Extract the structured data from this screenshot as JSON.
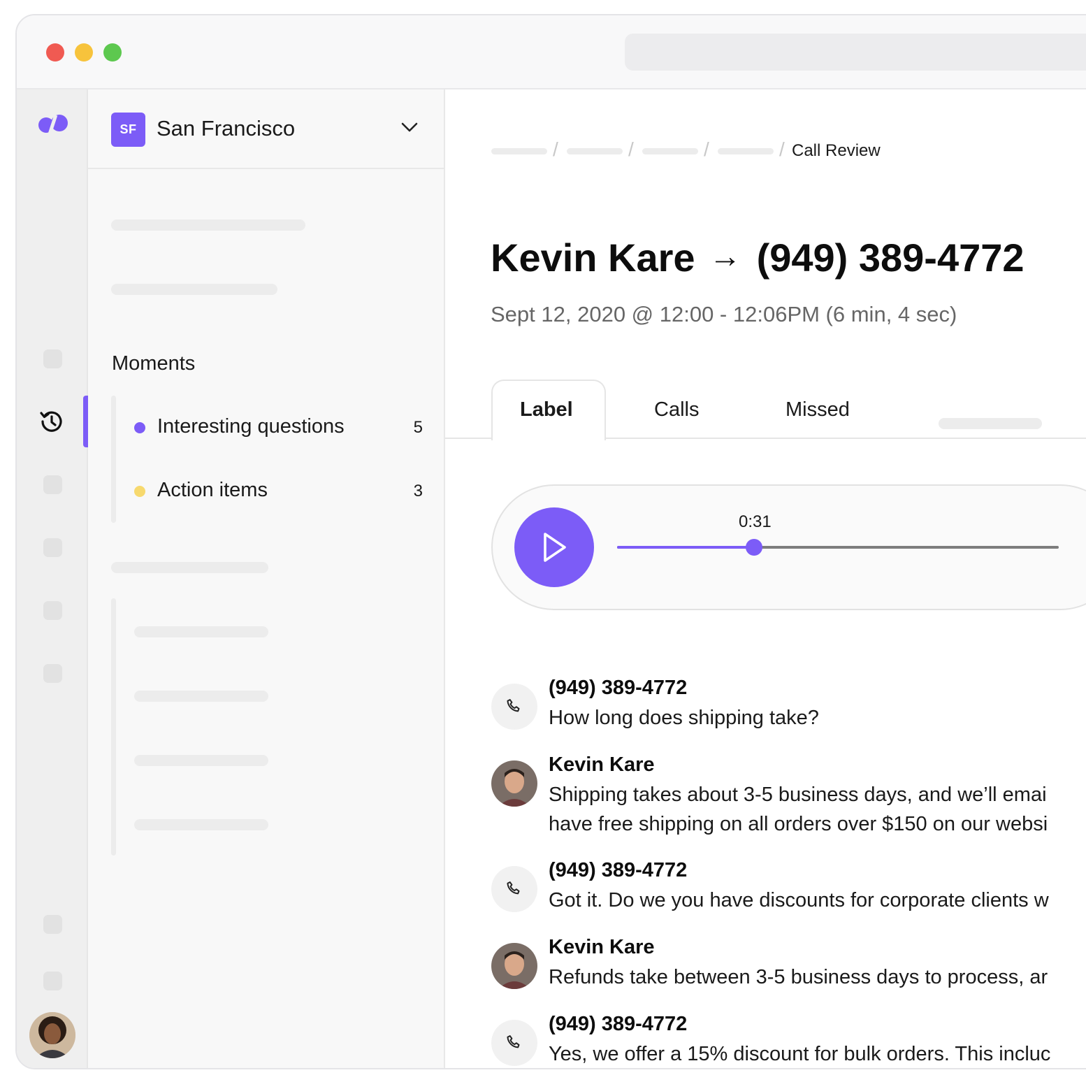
{
  "colors": {
    "accent": "#7c5cf7",
    "yellow_dot": "#f7d96e"
  },
  "org": {
    "badge": "SF",
    "name": "San Francisco"
  },
  "moments": {
    "title": "Moments",
    "items": [
      {
        "label": "Interesting questions",
        "count": "5",
        "color": "#7c5cf7"
      },
      {
        "label": "Action items",
        "count": "3",
        "color": "#f7d96e"
      }
    ]
  },
  "breadcrumb": {
    "current": "Call Review"
  },
  "call": {
    "caller": "Kevin Kare",
    "arrow": "→",
    "number": "(949) 389-4772",
    "meta": "Sept 12, 2020 @ 12:00 - 12:06PM (6 min, 4 sec)"
  },
  "tabs": [
    "Label",
    "Calls",
    "Missed"
  ],
  "player": {
    "time": "0:31",
    "progress": 0.31
  },
  "transcript": [
    {
      "speaker": "(949) 389-4772",
      "type": "phone",
      "text": "How long does shipping take?"
    },
    {
      "speaker": "Kevin Kare",
      "type": "agent",
      "text": "Shipping takes about 3-5 business days, and we’ll emai\nhave free shipping on all orders over $150 on our websi"
    },
    {
      "speaker": "(949) 389-4772",
      "type": "phone",
      "text": "Got it. Do we you have discounts for corporate clients w"
    },
    {
      "speaker": "Kevin Kare",
      "type": "agent",
      "text": "Refunds take between 3-5 business days to process, ar"
    },
    {
      "speaker": "(949) 389-4772",
      "type": "phone",
      "text": "Yes, we offer a 15% discount for bulk orders. This incluc"
    }
  ]
}
